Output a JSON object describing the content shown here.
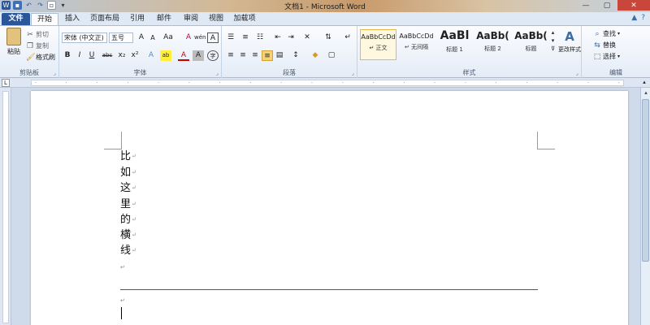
{
  "window": {
    "title": "文档1 - Microsoft Word",
    "qat_icons": [
      "word-app-icon",
      "save-icon",
      "undo-icon",
      "redo-icon",
      "new-doc-icon",
      "customize-qat-icon"
    ],
    "controls": {
      "minimize": "—",
      "maximize": "▢",
      "close": "✕"
    }
  },
  "tabs": [
    {
      "label": "文件",
      "kind": "file"
    },
    {
      "label": "开始",
      "kind": "active"
    },
    {
      "label": "插入",
      "kind": "normal"
    },
    {
      "label": "页面布局",
      "kind": "normal"
    },
    {
      "label": "引用",
      "kind": "normal"
    },
    {
      "label": "邮件",
      "kind": "normal"
    },
    {
      "label": "审阅",
      "kind": "normal"
    },
    {
      "label": "视图",
      "kind": "normal"
    },
    {
      "label": "加载项",
      "kind": "normal"
    }
  ],
  "tab_extra": {
    "minimize_ribbon": "▲",
    "help": "?"
  },
  "ribbon": {
    "clipboard": {
      "label": "剪贴板",
      "paste": "粘贴",
      "cut": "剪切",
      "copy": "复制",
      "format_painter": "格式刷"
    },
    "font": {
      "label": "字体",
      "font_name": "宋体 (中文正)",
      "font_size": "五号",
      "bold": "B",
      "italic": "I",
      "underline": "U",
      "strikethrough": "abc",
      "subscript": "x₂",
      "superscript": "x²",
      "font_color": "A",
      "grow": "A",
      "shrink": "A",
      "change_case": "Aa",
      "clear_format": "A",
      "phonetic": "wén",
      "char_border": "A",
      "highlight": "ab",
      "text_effect": "A",
      "char_shading": "A",
      "enclose": "字"
    },
    "paragraph": {
      "label": "段落"
    },
    "styles": {
      "label": "样式",
      "items": [
        {
          "preview": "AaBbCcDd",
          "name": "↵ 正文",
          "active": true
        },
        {
          "preview": "AaBbCcDd",
          "name": "↵ 无间隔",
          "active": false
        },
        {
          "preview": "AaBl",
          "name": "标题 1",
          "active": false
        },
        {
          "preview": "AaBb(",
          "name": "标题 2",
          "active": false
        },
        {
          "preview": "AaBb(",
          "name": "标题",
          "active": false
        }
      ],
      "change_styles": "更改样式"
    },
    "editing": {
      "label": "编辑",
      "find": "查找",
      "replace": "替换",
      "select": "选择"
    }
  },
  "ruler": {
    "tab_selector": "L"
  },
  "document": {
    "lines": [
      "比",
      "如",
      "这",
      "里",
      "的",
      "横",
      "线"
    ],
    "paragraph_mark": "↵"
  }
}
